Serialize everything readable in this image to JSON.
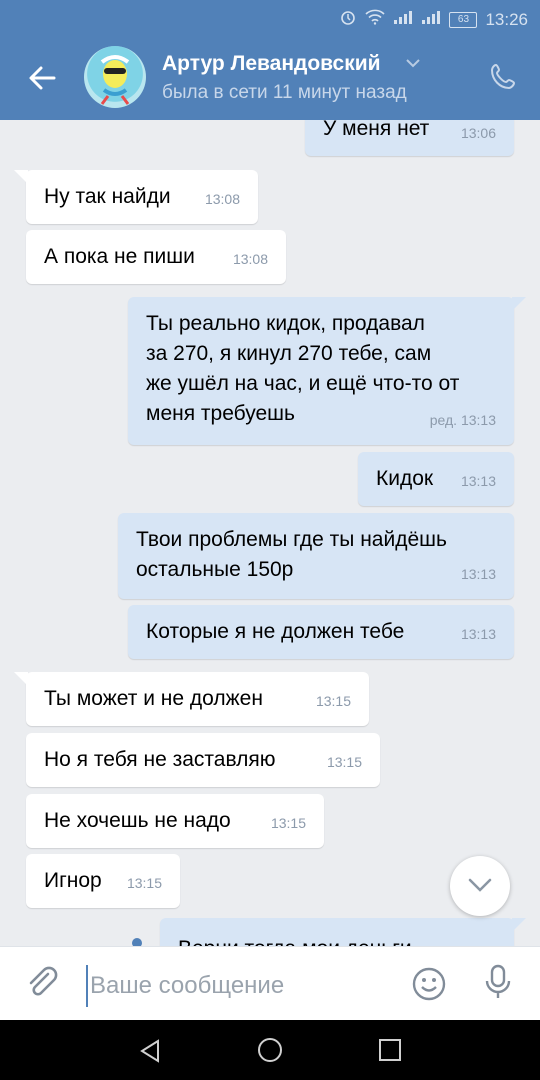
{
  "status_bar": {
    "time": "13:26",
    "battery": "63"
  },
  "header": {
    "contact_name": "Артур Левандовский",
    "last_seen": "была в сети 11 минут назад"
  },
  "messages": [
    {
      "dir": "out",
      "text": "У меня нет",
      "time": "13:06"
    },
    {
      "dir": "in",
      "text": "Ну так найди",
      "time": "13:08"
    },
    {
      "dir": "in",
      "text": "А пока не пиши",
      "time": "13:08"
    },
    {
      "dir": "out",
      "text": "Ты реально кидок, продавал\nза 270, я кинул 270 тебе, сам\nже ушёл на час, и ещё что-то от\nменя требуешь",
      "time": "ред. 13:13"
    },
    {
      "dir": "out",
      "text": "Кидок",
      "time": "13:13"
    },
    {
      "dir": "out",
      "text": "Твои проблемы где ты найдёшь\nостальные 150р",
      "time": "13:13"
    },
    {
      "dir": "out",
      "text": "Которые я не должен тебе",
      "time": "13:13"
    },
    {
      "dir": "in",
      "text": "Ты может и не должен",
      "time": "13:15"
    },
    {
      "dir": "in",
      "text": "Но я тебя не заставляю",
      "time": "13:15"
    },
    {
      "dir": "in",
      "text": "Не хочешь не надо",
      "time": "13:15"
    },
    {
      "dir": "in",
      "text": "Игнор",
      "time": "13:15"
    },
    {
      "dir": "out",
      "text": "Верни тогда мои деньги",
      "time": ""
    }
  ],
  "composer": {
    "placeholder": "Ваше сообщение"
  }
}
